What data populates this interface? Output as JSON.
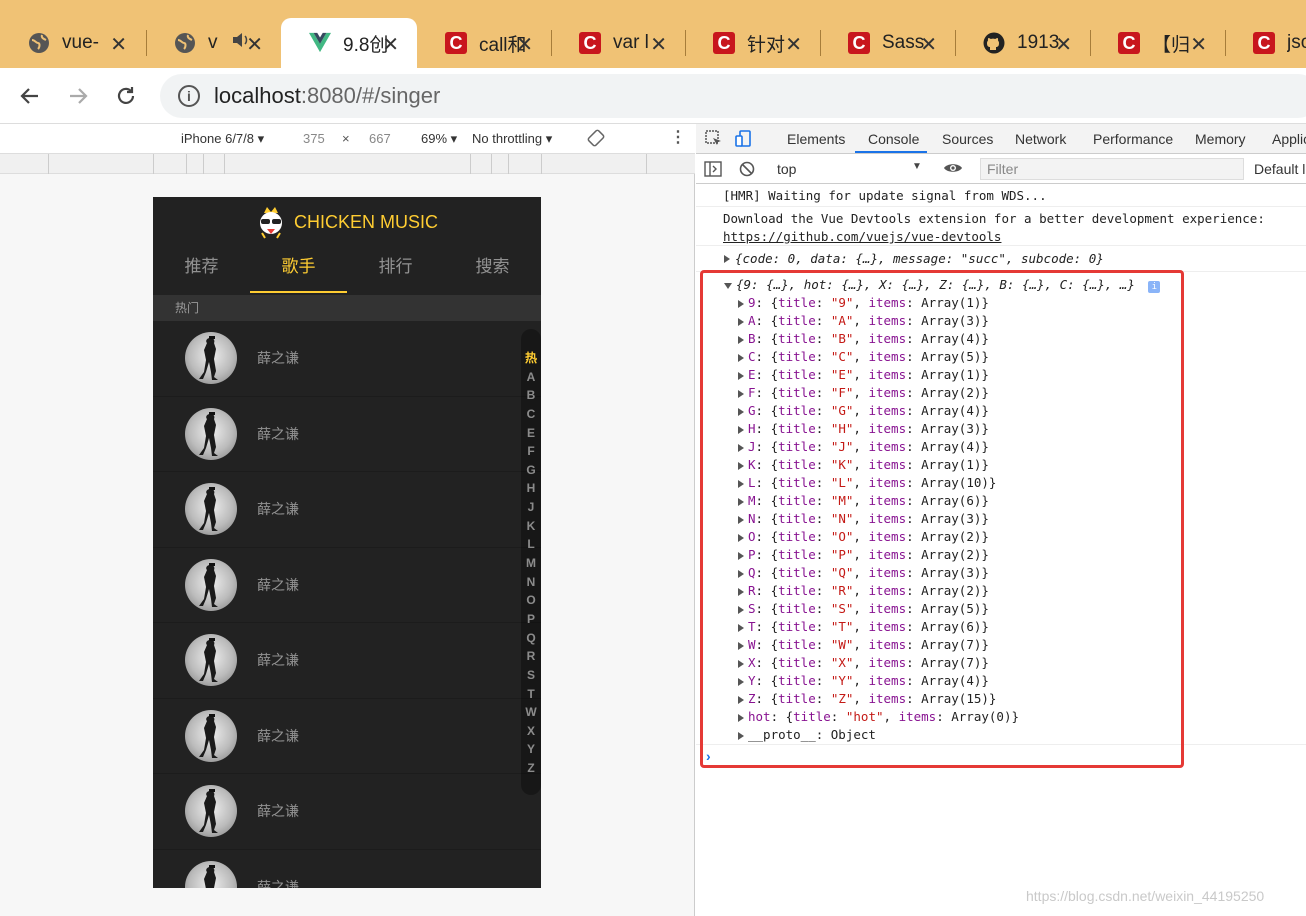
{
  "browser": {
    "tabs": [
      {
        "title": "vue-",
        "icon": "globe-icon"
      },
      {
        "title": "v",
        "icon": "globe-icon"
      },
      {
        "title": "9.8创",
        "icon": "vue-logo-icon"
      },
      {
        "title": "call和",
        "icon": "csdn-icon"
      },
      {
        "title": "var l",
        "icon": "csdn-icon"
      },
      {
        "title": "针对",
        "icon": "csdn-icon"
      },
      {
        "title": "Sass",
        "icon": "csdn-icon"
      },
      {
        "title": "1913",
        "icon": "github-icon"
      },
      {
        "title": "【归",
        "icon": "csdn-icon"
      },
      {
        "title": "json",
        "icon": "csdn-icon"
      }
    ],
    "close_glyph": "✕",
    "url_host": "localhost",
    "url_path": ":8080/#/singer"
  },
  "device": {
    "model": "iPhone 6/7/8 ▾",
    "width": "375",
    "times": "×",
    "height": "667",
    "zoom": "69% ▾",
    "throttle": "No throttling ▾"
  },
  "app": {
    "title": "CHICKEN MUSIC",
    "tabs": [
      "推荐",
      "歌手",
      "排行",
      "搜索"
    ],
    "active_tab": 1,
    "group_title": "热门",
    "singers": [
      "薛之谦",
      "薛之谦",
      "薛之谦",
      "薛之谦",
      "薛之谦",
      "薛之谦",
      "薛之谦",
      "薛之谦"
    ],
    "shortcut": [
      "热",
      "A",
      "B",
      "C",
      "E",
      "F",
      "G",
      "H",
      "J",
      "K",
      "L",
      "M",
      "N",
      "O",
      "P",
      "Q",
      "R",
      "S",
      "T",
      "W",
      "X",
      "Y",
      "Z"
    ]
  },
  "devtools": {
    "tabs": [
      "Elements",
      "Console",
      "Sources",
      "Network",
      "Performance",
      "Memory",
      "Applic"
    ],
    "active_tab": "Console",
    "context": "top",
    "filter_placeholder": "Filter",
    "levels": "Default le",
    "logs": [
      "[HMR] Waiting for update signal from WDS...",
      "Download the Vue Devtools extension for a better development experience:",
      "https://github.com/vuejs/vue-devtools"
    ],
    "response_summary": "{code: 0, data: {…}, message: \"succ\", subcode: 0}",
    "object_summary": "{9: {…}, hot: {…}, X: {…}, Z: {…}, B: {…}, C: {…}, …}",
    "entries": [
      {
        "key": "9",
        "count": "1"
      },
      {
        "key": "A",
        "count": "3"
      },
      {
        "key": "B",
        "count": "4"
      },
      {
        "key": "C",
        "count": "5"
      },
      {
        "key": "E",
        "count": "1"
      },
      {
        "key": "F",
        "count": "2"
      },
      {
        "key": "G",
        "count": "4"
      },
      {
        "key": "H",
        "count": "3"
      },
      {
        "key": "J",
        "count": "4"
      },
      {
        "key": "K",
        "count": "1"
      },
      {
        "key": "L",
        "count": "10"
      },
      {
        "key": "M",
        "count": "6"
      },
      {
        "key": "N",
        "count": "3"
      },
      {
        "key": "O",
        "count": "2"
      },
      {
        "key": "P",
        "count": "2"
      },
      {
        "key": "Q",
        "count": "3"
      },
      {
        "key": "R",
        "count": "2"
      },
      {
        "key": "S",
        "count": "5"
      },
      {
        "key": "T",
        "count": "6"
      },
      {
        "key": "W",
        "count": "7"
      },
      {
        "key": "X",
        "count": "7"
      },
      {
        "key": "Y",
        "count": "4"
      },
      {
        "key": "Z",
        "count": "15"
      },
      {
        "key": "hot",
        "count": "0"
      }
    ],
    "proto_row": "__proto__: Object",
    "prompt": "›"
  },
  "watermark": "https://blog.csdn.net/weixin_44195250",
  "colors": {
    "accent": "#ffcd32",
    "highlight_box": "#e53935",
    "tabstrip": "#f0c275"
  }
}
